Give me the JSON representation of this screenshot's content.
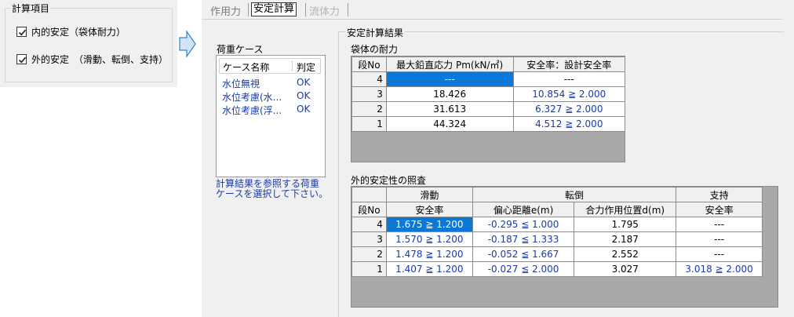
{
  "calc_items": {
    "legend": "計算項目",
    "options": [
      {
        "label": "内的安定（袋体耐力）",
        "checked": true
      },
      {
        "label": "外的安定　（滑動、転倒、支持）",
        "checked": true
      }
    ]
  },
  "tabs": {
    "sakuyou": "作用力",
    "antei": "安定計算",
    "ryuutai": "流体力"
  },
  "load_case": {
    "title": "荷重ケース",
    "header_name": "ケース名称",
    "header_result": "判定",
    "rows": [
      {
        "name": "水位無視",
        "result": "OK"
      },
      {
        "name": "水位考慮(水...",
        "result": "OK"
      },
      {
        "name": "水位考慮(浮...",
        "result": "OK"
      }
    ],
    "hint_line1": "計算結果を参照する荷重",
    "hint_line2": "ケースを選択して下さい。"
  },
  "results": {
    "legend": "安定計算結果",
    "bag_strength": {
      "title": "袋体の耐力",
      "headers": [
        "段No",
        "最大鉛直応力 Pm(kN/㎡)",
        "安全率：設計安全率"
      ],
      "rows": [
        {
          "no": "4",
          "pm": "---",
          "sf": "---"
        },
        {
          "no": "3",
          "pm": "18.426",
          "sf": "10.854 ≧ 2.000"
        },
        {
          "no": "2",
          "pm": "31.613",
          "sf": "6.327 ≧ 2.000"
        },
        {
          "no": "1",
          "pm": "44.324",
          "sf": "4.512 ≧ 2.000"
        }
      ]
    },
    "external": {
      "title": "外的安定性の照査",
      "group_headers": [
        "滑動",
        "転倒",
        "支持"
      ],
      "headers": [
        "段No",
        "安全率",
        "偏心距離e(m)",
        "合力作用位置d(m)",
        "安全率"
      ],
      "rows": [
        {
          "no": "4",
          "slide": "1.675 ≧ 1.200",
          "ecc": "-0.295 ≦ 1.000",
          "d": "1.795",
          "support": "---"
        },
        {
          "no": "3",
          "slide": "1.570 ≧ 1.200",
          "ecc": "-0.187 ≦ 1.333",
          "d": "2.187",
          "support": "---"
        },
        {
          "no": "2",
          "slide": "1.478 ≧ 1.200",
          "ecc": "-0.052 ≦ 1.667",
          "d": "2.552",
          "support": "---"
        },
        {
          "no": "1",
          "slide": "1.407 ≧ 1.200",
          "ecc": "-0.027 ≦ 2.000",
          "d": "3.027",
          "support": "3.018 ≧ 2.000"
        }
      ]
    }
  },
  "colors": {
    "panel_bg": "#f0f0f0",
    "link_blue": "#1a3aa8",
    "selection": "#0b78d7",
    "grid_empty": "#a9a9a9",
    "arrow_fill": "#cfe4f7",
    "arrow_stroke": "#3b7fc4"
  },
  "icons": {
    "next_arrow": "right-arrow-icon",
    "check": "checkmark-icon"
  }
}
